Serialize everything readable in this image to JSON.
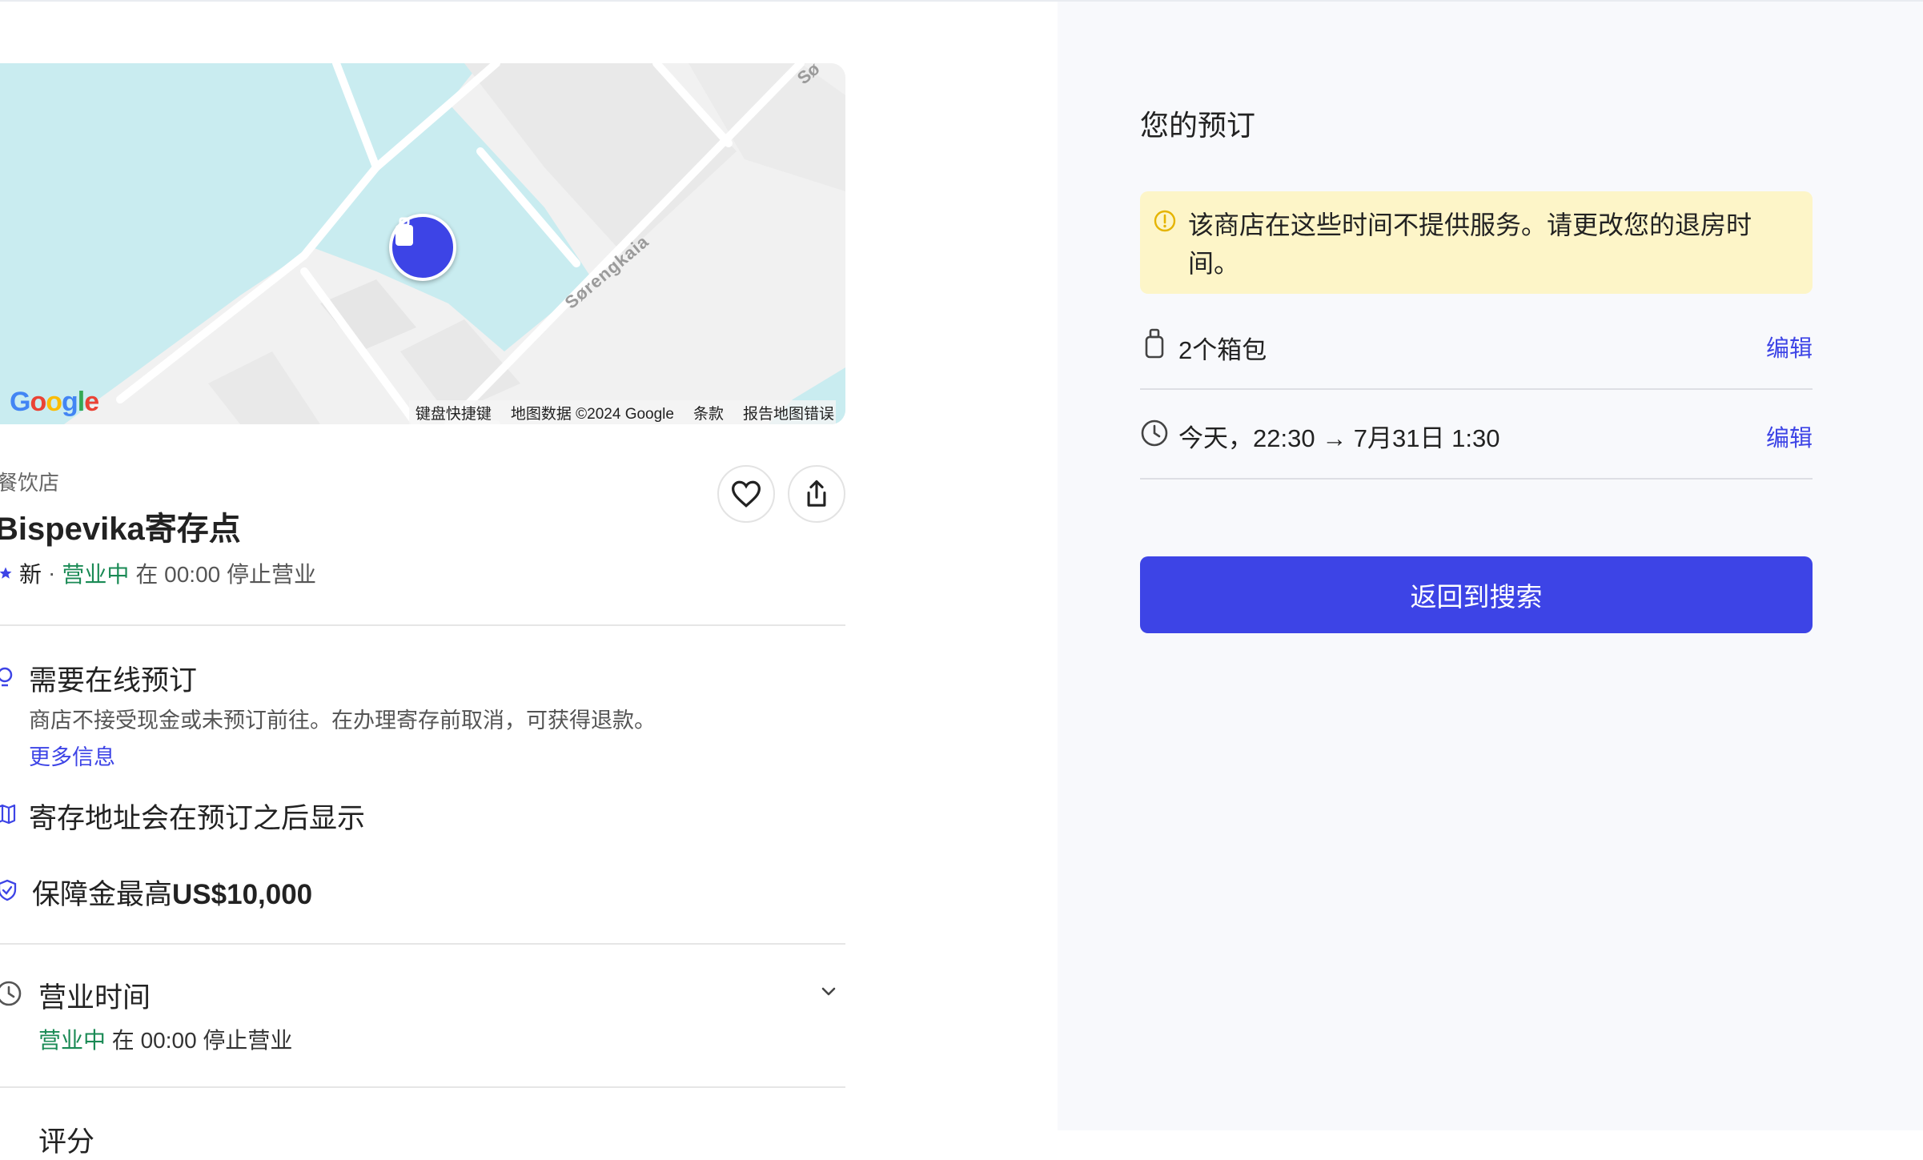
{
  "map": {
    "street_label": "Sørengkaia",
    "street_label_partial": "Sø",
    "google_logo": "Google",
    "footer": {
      "shortcuts": "键盘快捷键",
      "map_data": "地图数据 ©2024 Google",
      "terms": "条款",
      "report": "报告地图错误"
    }
  },
  "store": {
    "category": "餐饮店",
    "name": "Bispevika寄存点",
    "new_label": "新",
    "separator": "·",
    "status": "营业中",
    "closing": "在 00:00 停止营业"
  },
  "features": {
    "online_booking": {
      "title": "需要在线预订",
      "description": "商店不接受现金或未预订前往。在办理寄存前取消，可获得退款。",
      "more": "更多信息"
    },
    "address": {
      "title": "寄存地址会在预订之后显示"
    },
    "guarantee": {
      "prefix": "保障金最高",
      "amount": "US$10,000"
    }
  },
  "hours": {
    "title": "营业时间",
    "status": "营业中",
    "closing": "在 00:00 停止营业",
    "next_partial": "评分"
  },
  "booking": {
    "title": "您的预订",
    "alert": "该商店在这些时间不提供服务。请更改您的退房时间。",
    "bags": "2个箱包",
    "bags_edit": "编辑",
    "time": "今天，22:30 → 7月31日 1:30",
    "time_edit": "编辑",
    "cta": "返回到搜索"
  },
  "colors": {
    "accent": "#3d44e6",
    "open_green": "#1a8a55",
    "alert_bg": "#fdf5c8",
    "water": "#c9ecf0"
  }
}
